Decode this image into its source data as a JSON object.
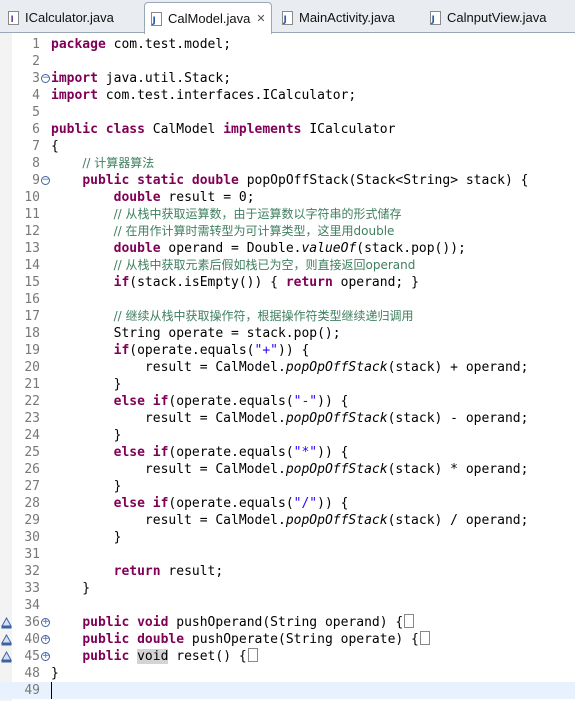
{
  "tabs": [
    {
      "label": "ICalculator.java",
      "active": false
    },
    {
      "label": "CalModel.java",
      "active": true
    },
    {
      "label": "MainActivity.java",
      "active": false
    },
    {
      "label": "CalnputView.java",
      "active": false
    }
  ],
  "close_glyph": "✕",
  "lines": [
    {
      "n": "1",
      "parts": [
        [
          "kw",
          "package"
        ],
        [
          "",
          "com.test.model;"
        ]
      ]
    },
    {
      "n": "2",
      "parts": []
    },
    {
      "n": "3",
      "fold": "−",
      "parts": [
        [
          "kw",
          "import"
        ],
        [
          "",
          "java.util.Stack;"
        ]
      ]
    },
    {
      "n": "4",
      "parts": [
        [
          "kw",
          "import"
        ],
        [
          "",
          "com.test.interfaces.ICalculator;"
        ]
      ]
    },
    {
      "n": "5",
      "parts": []
    },
    {
      "n": "6",
      "parts": [
        [
          "kw",
          "public"
        ],
        [
          "kw",
          "class"
        ],
        [
          "",
          "CalModel"
        ],
        [
          "kw",
          "implements"
        ],
        [
          "",
          "ICalculator"
        ]
      ]
    },
    {
      "n": "7",
      "parts": [
        [
          "",
          "{"
        ]
      ]
    },
    {
      "n": "8",
      "parts": [
        [
          "",
          "    "
        ],
        [
          "cm",
          "// 计算器算法"
        ]
      ]
    },
    {
      "n": "9",
      "fold": "−",
      "parts": [
        [
          "",
          "    "
        ],
        [
          "kw",
          "public"
        ],
        [
          "kw",
          "static"
        ],
        [
          "kw",
          "double"
        ],
        [
          "",
          "popOpOffStack(Stack<String> stack) {"
        ]
      ]
    },
    {
      "n": "10",
      "parts": [
        [
          "",
          "        "
        ],
        [
          "kw",
          "double"
        ],
        [
          "",
          "result = 0;"
        ]
      ]
    },
    {
      "n": "11",
      "parts": [
        [
          "",
          "        "
        ],
        [
          "cm",
          "// 从栈中获取运算数，由于运算数以字符串的形式储存"
        ]
      ]
    },
    {
      "n": "12",
      "parts": [
        [
          "",
          "        "
        ],
        [
          "cm",
          "// 在用作计算时需转型为可计算类型，这里用double"
        ]
      ]
    },
    {
      "n": "13",
      "parts": [
        [
          "",
          "        "
        ],
        [
          "kw",
          "double"
        ],
        [
          "",
          "operand = Double."
        ],
        [
          "it",
          "valueOf"
        ],
        [
          "",
          "(stack.pop());"
        ]
      ]
    },
    {
      "n": "14",
      "parts": [
        [
          "",
          "        "
        ],
        [
          "cm",
          "// 从栈中获取元素后假如栈已为空，则直接返回operand"
        ]
      ]
    },
    {
      "n": "15",
      "parts": [
        [
          "",
          "        "
        ],
        [
          "kw",
          "if"
        ],
        [
          "",
          "(stack.isEmpty()) { "
        ],
        [
          "kw",
          "return"
        ],
        [
          "",
          "operand; }"
        ]
      ]
    },
    {
      "n": "16",
      "parts": []
    },
    {
      "n": "17",
      "parts": [
        [
          "",
          "        "
        ],
        [
          "cm",
          "// 继续从栈中获取操作符，根据操作符类型继续递归调用"
        ]
      ]
    },
    {
      "n": "18",
      "parts": [
        [
          "",
          "        String operate = stack.pop();"
        ]
      ]
    },
    {
      "n": "19",
      "parts": [
        [
          "",
          "        "
        ],
        [
          "kw",
          "if"
        ],
        [
          "",
          "(operate.equals("
        ],
        [
          "st",
          "\"+\""
        ],
        [
          "",
          ")) {"
        ]
      ]
    },
    {
      "n": "20",
      "parts": [
        [
          "",
          "            result = CalModel."
        ],
        [
          "it",
          "popOpOffStack"
        ],
        [
          "",
          "(stack) + operand;"
        ]
      ]
    },
    {
      "n": "21",
      "parts": [
        [
          "",
          "        }"
        ]
      ]
    },
    {
      "n": "22",
      "parts": [
        [
          "",
          "        "
        ],
        [
          "kw",
          "else"
        ],
        [
          "kw",
          "if"
        ],
        [
          "",
          "(operate.equals("
        ],
        [
          "st",
          "\"-\""
        ],
        [
          "",
          ")) {"
        ]
      ]
    },
    {
      "n": "23",
      "parts": [
        [
          "",
          "            result = CalModel."
        ],
        [
          "it",
          "popOpOffStack"
        ],
        [
          "",
          "(stack) - operand;"
        ]
      ]
    },
    {
      "n": "24",
      "parts": [
        [
          "",
          "        }"
        ]
      ]
    },
    {
      "n": "25",
      "parts": [
        [
          "",
          "        "
        ],
        [
          "kw",
          "else"
        ],
        [
          "kw",
          "if"
        ],
        [
          "",
          "(operate.equals("
        ],
        [
          "st",
          "\"*\""
        ],
        [
          "",
          ")) {"
        ]
      ]
    },
    {
      "n": "26",
      "parts": [
        [
          "",
          "            result = CalModel."
        ],
        [
          "it",
          "popOpOffStack"
        ],
        [
          "",
          "(stack) * operand;"
        ]
      ]
    },
    {
      "n": "27",
      "parts": [
        [
          "",
          "        }"
        ]
      ]
    },
    {
      "n": "28",
      "parts": [
        [
          "",
          "        "
        ],
        [
          "kw",
          "else"
        ],
        [
          "kw",
          "if"
        ],
        [
          "",
          "(operate.equals("
        ],
        [
          "st",
          "\"/\""
        ],
        [
          "",
          ")) {"
        ]
      ]
    },
    {
      "n": "29",
      "parts": [
        [
          "",
          "            result = CalModel."
        ],
        [
          "it",
          "popOpOffStack"
        ],
        [
          "",
          "(stack) / operand;"
        ]
      ]
    },
    {
      "n": "30",
      "parts": [
        [
          "",
          "        }"
        ]
      ]
    },
    {
      "n": "31",
      "parts": []
    },
    {
      "n": "32",
      "parts": [
        [
          "",
          "        "
        ],
        [
          "kw",
          "return"
        ],
        [
          "",
          "result;"
        ]
      ]
    },
    {
      "n": "33",
      "parts": [
        [
          "",
          "    }"
        ]
      ]
    },
    {
      "n": "34",
      "parts": []
    },
    {
      "n": "36",
      "fold": "+",
      "marker": true,
      "parts": [
        [
          "",
          "    "
        ],
        [
          "kw",
          "public"
        ],
        [
          "kw",
          "void"
        ],
        [
          "",
          "pushOperand(String operand) {"
        ],
        [
          "box",
          ""
        ]
      ]
    },
    {
      "n": "40",
      "fold": "+",
      "marker": true,
      "parts": [
        [
          "",
          "    "
        ],
        [
          "kw",
          "public"
        ],
        [
          "kw",
          "double"
        ],
        [
          "",
          "pushOperate(String operate) {"
        ],
        [
          "box",
          ""
        ]
      ]
    },
    {
      "n": "45",
      "fold": "+",
      "marker": true,
      "parts": [
        [
          "",
          "    "
        ],
        [
          "kw",
          "public"
        ],
        [
          "occ",
          "void"
        ],
        [
          "",
          "reset() {"
        ],
        [
          "box",
          ""
        ]
      ]
    },
    {
      "n": "48",
      "parts": [
        [
          "",
          "}"
        ]
      ]
    },
    {
      "n": "49",
      "cursor": true,
      "parts": []
    }
  ]
}
